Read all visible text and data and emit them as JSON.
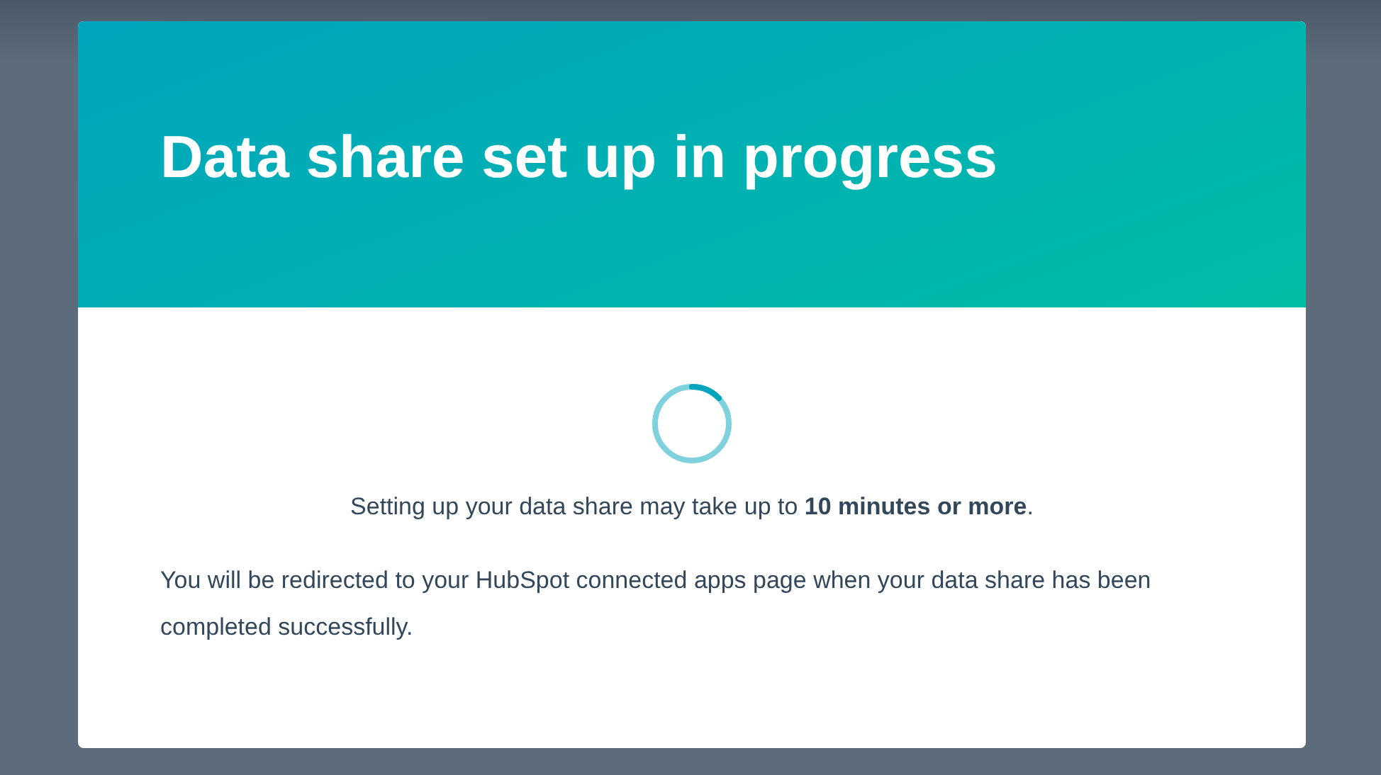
{
  "modal": {
    "title": "Data share set up in progress",
    "message": "Setting up your data share may take up to **10 minutes or more**.",
    "note": "You will be redirected to your HubSpot connected apps page when your data share has been completed successfully."
  }
}
